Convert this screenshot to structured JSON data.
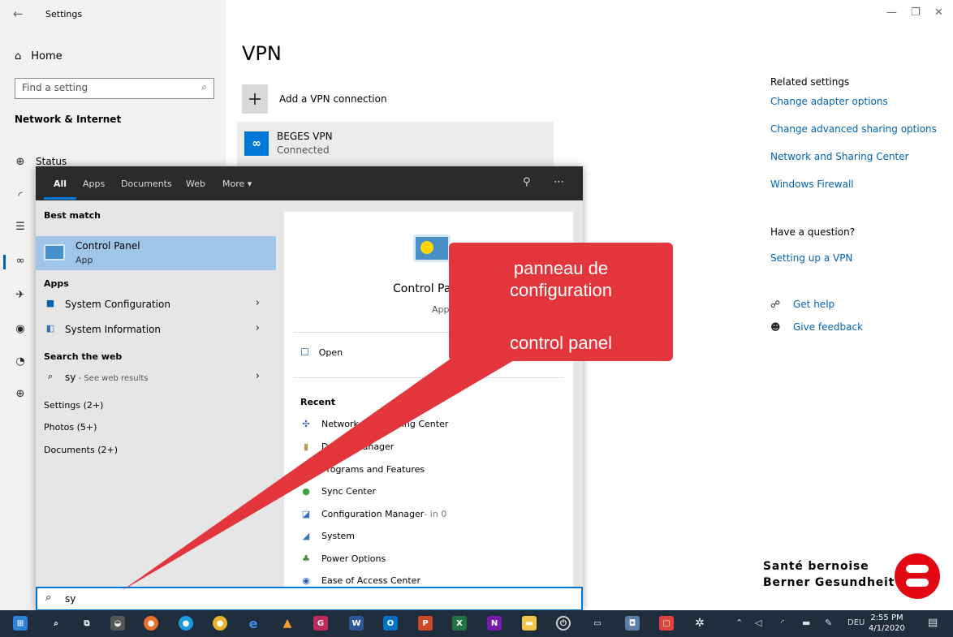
{
  "window": {
    "title": "Settings"
  },
  "sidebar": {
    "home": "Home",
    "search_placeholder": "Find a setting",
    "section": "Network & Internet",
    "status": "Status"
  },
  "main": {
    "title": "VPN",
    "add_vpn": "Add a VPN connection",
    "connection": {
      "name": "BEGES VPN",
      "status": "Connected"
    }
  },
  "related": {
    "heading": "Related settings",
    "links": [
      "Change adapter options",
      "Change advanced sharing options",
      "Network and Sharing Center",
      "Windows Firewall"
    ],
    "question": "Have a question?",
    "question_link": "Setting up a VPN",
    "help": "Get help",
    "feedback": "Give feedback"
  },
  "brand": {
    "line1": "Santé bernoise",
    "line2": "Berner Gesundheit",
    "color": "#e30613"
  },
  "search": {
    "tabs": [
      "All",
      "Apps",
      "Documents",
      "Web",
      "More ▾"
    ],
    "best_match_header": "Best match",
    "best_match": {
      "name": "Control Panel",
      "type": "App"
    },
    "apps_header": "Apps",
    "apps": [
      "System Configuration",
      "System Information"
    ],
    "web_header": "Search the web",
    "web": {
      "query": "sy",
      "suffix": " - See web results"
    },
    "groups": [
      "Settings (2+)",
      "Photos (5+)",
      "Documents (2+)"
    ],
    "query": "sy",
    "preview": {
      "name": "Control Panel",
      "type": "App",
      "open": "Open",
      "recent_header": "Recent",
      "recent": [
        {
          "label": "Network and Sharing Center",
          "suffix": ""
        },
        {
          "label": "Device Manager",
          "suffix": ""
        },
        {
          "label": "Programs and Features",
          "suffix": ""
        },
        {
          "label": "Sync Center",
          "suffix": ""
        },
        {
          "label": "Configuration Manager",
          "suffix": " - in 0"
        },
        {
          "label": "System",
          "suffix": ""
        },
        {
          "label": "Power Options",
          "suffix": ""
        },
        {
          "label": "Ease of Access Center",
          "suffix": ""
        }
      ]
    }
  },
  "callout": {
    "line1": "panneau de",
    "line2": "configuration",
    "line3": "control panel",
    "color": "#e2363c"
  },
  "taskbar": {
    "language": "DEU",
    "time": "2:55 PM",
    "date": "4/1/2020"
  }
}
